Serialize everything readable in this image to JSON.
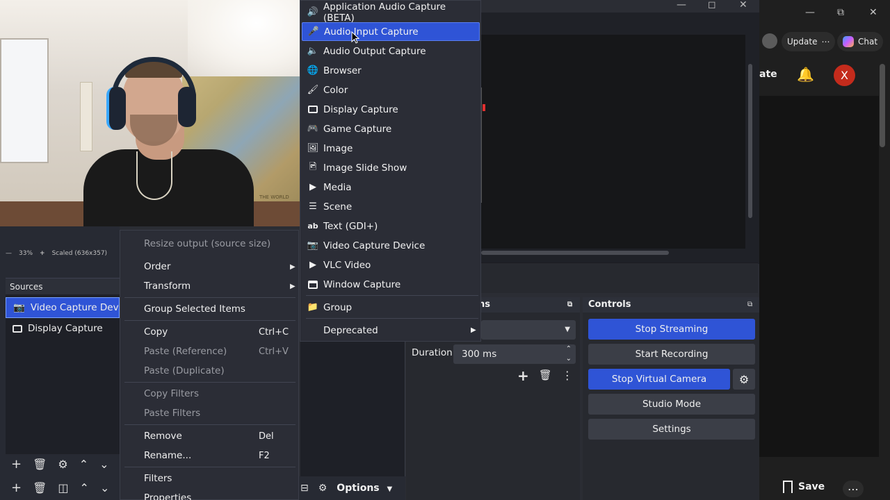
{
  "webcam": {
    "map_text": "THE WORLD"
  },
  "zoom_bar": {
    "zoom": "33%",
    "scaled": "Scaled (636x357)"
  },
  "sources": {
    "title": "Sources",
    "items": [
      {
        "label": "Video Capture Device",
        "icon": "camera-icon",
        "selected": true
      },
      {
        "label": "Display Capture",
        "icon": "monitor-icon",
        "selected": false
      }
    ]
  },
  "context_menu": {
    "resize": "Resize output (source size)",
    "order": "Order",
    "transform": "Transform",
    "group_selected": "Group Selected Items",
    "copy": "Copy",
    "copy_sc": "Ctrl+C",
    "paste_ref": "Paste (Reference)",
    "paste_ref_sc": "Ctrl+V",
    "paste_dup": "Paste (Duplicate)",
    "copy_filters": "Copy Filters",
    "paste_filters": "Paste Filters",
    "remove": "Remove",
    "remove_sc": "Del",
    "rename": "Rename...",
    "rename_sc": "F2",
    "filters": "Filters",
    "properties": "Properties"
  },
  "add_source_menu": {
    "items": [
      "Application Audio Capture (BETA)",
      "Audio Input Capture",
      "Audio Output Capture",
      "Browser",
      "Color",
      "Display Capture",
      "Game Capture",
      "Image",
      "Image Slide Show",
      "Media",
      "Scene",
      "Text (GDI+)",
      "Video Capture Device",
      "VLC Video",
      "Window Capture"
    ],
    "highlighted": "Audio Input Capture",
    "group": "Group",
    "deprecated": "Deprecated"
  },
  "transitions": {
    "title_fragment": "ns",
    "duration_label": "Duration",
    "duration_value": "300 ms"
  },
  "mid_panel": {
    "options": "Options"
  },
  "controls": {
    "title": "Controls",
    "stop_streaming": "Stop Streaming",
    "start_recording": "Start Recording",
    "stop_virtual_camera": "Stop Virtual Camera",
    "studio_mode": "Studio Mode",
    "settings": "Settings"
  },
  "browser": {
    "update": "Update",
    "chat": "Chat",
    "partial_text": "ate",
    "avatar_letter": "X",
    "save": "Save"
  },
  "colors": {
    "accent": "#2f54d6",
    "panel": "#27292f",
    "menu": "#2b2d36"
  }
}
